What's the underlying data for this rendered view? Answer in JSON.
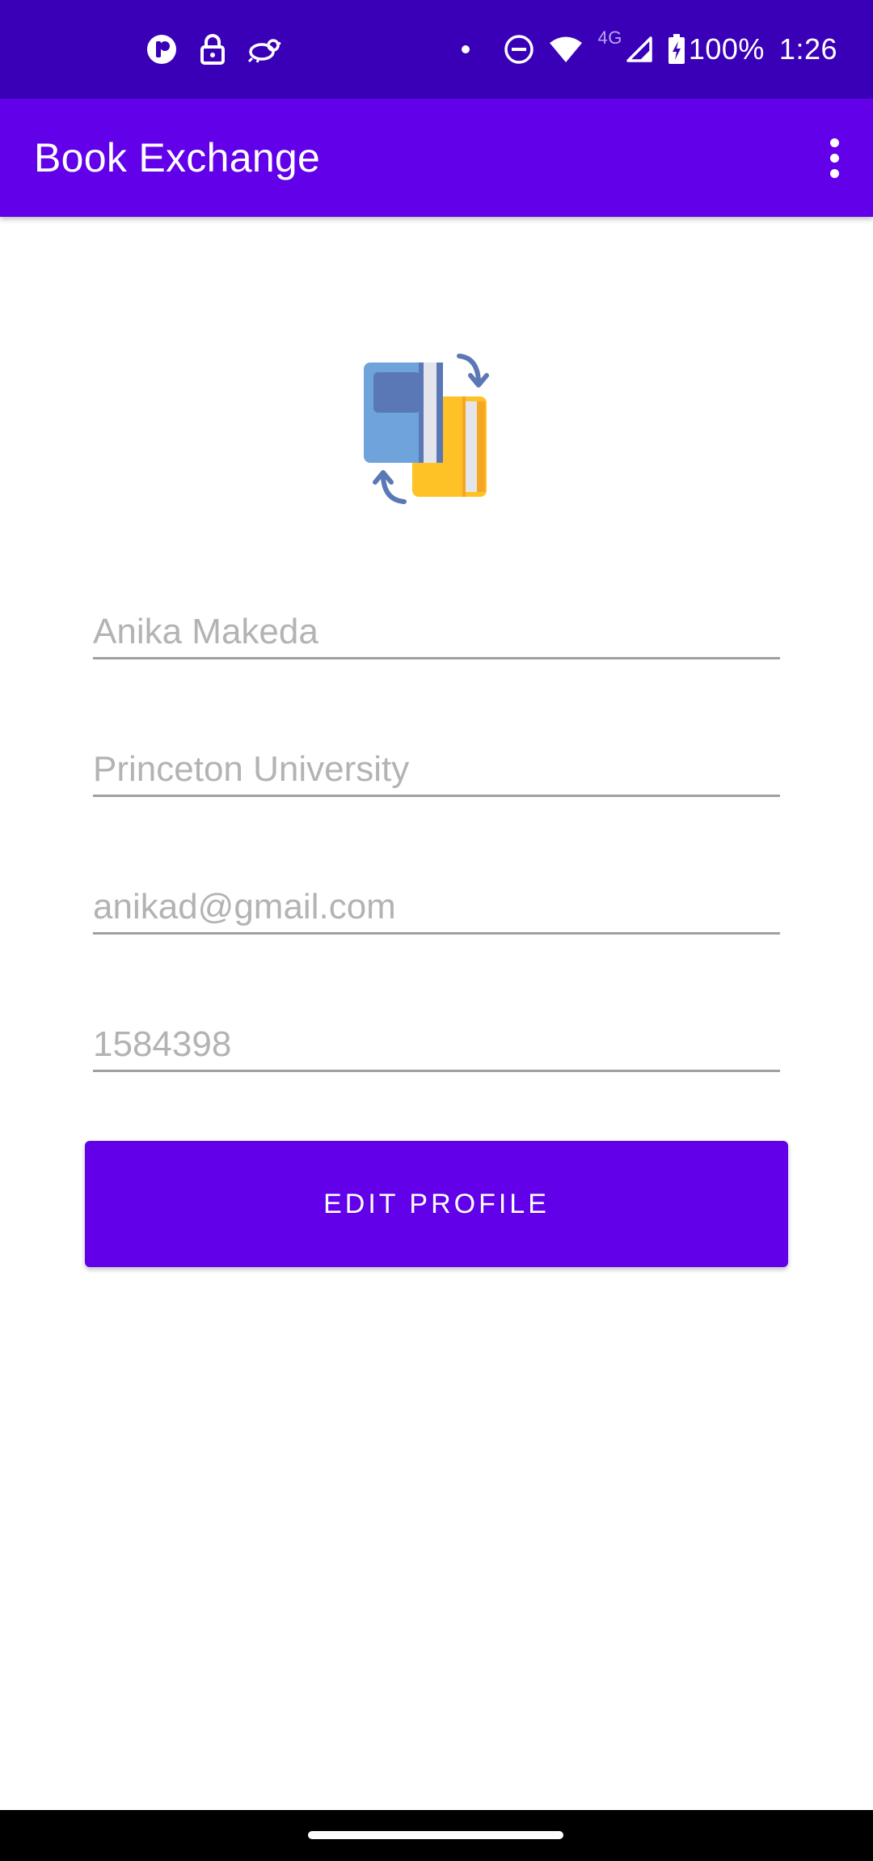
{
  "status_bar": {
    "time": "1:26",
    "battery": "100%",
    "network": "4G",
    "left_icons": [
      "notification-app-icon",
      "lock-icon",
      "bird-icon"
    ],
    "right_icons": [
      "dot-icon",
      "do-not-disturb-icon",
      "wifi-icon",
      "cell-signal-icon",
      "battery-charging-icon"
    ]
  },
  "app_bar": {
    "title": "Book Exchange",
    "overflow_icon": "more-vert-icon"
  },
  "logo": {
    "icon": "book-exchange-icon",
    "colors": {
      "blue_book": "#6fa3dc",
      "yellow_book": "#ffc226",
      "arrow": "#5b78b6"
    }
  },
  "form": {
    "name_placeholder": "Anika Makeda",
    "university_placeholder": "Princeton University",
    "email_placeholder": "anikad@gmail.com",
    "id_placeholder": "1584398"
  },
  "edit_button_label": "EDIT PROFILE",
  "colors": {
    "status_bar": "#3a00b8",
    "primary": "#6200ea",
    "underline": "#a0a0a0",
    "placeholder": "#b3b3b3"
  }
}
